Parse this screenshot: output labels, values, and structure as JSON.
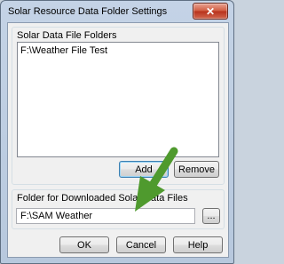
{
  "window": {
    "title": "Solar Resource Data Folder Settings",
    "close_glyph": "✕"
  },
  "folders_group": {
    "label": "Solar Data File Folders",
    "items": [
      "F:\\Weather File Test"
    ],
    "add_label": "Add",
    "remove_label": "Remove"
  },
  "download_group": {
    "label": "Folder for Downloaded Solar Data Files",
    "value": "F:\\SAM Weather",
    "browse_label": "..."
  },
  "footer": {
    "ok_label": "OK",
    "cancel_label": "Cancel",
    "help_label": "Help"
  },
  "annotation": {
    "arrow_color": "#4f9a2e",
    "icon": "green-arrow-icon"
  }
}
